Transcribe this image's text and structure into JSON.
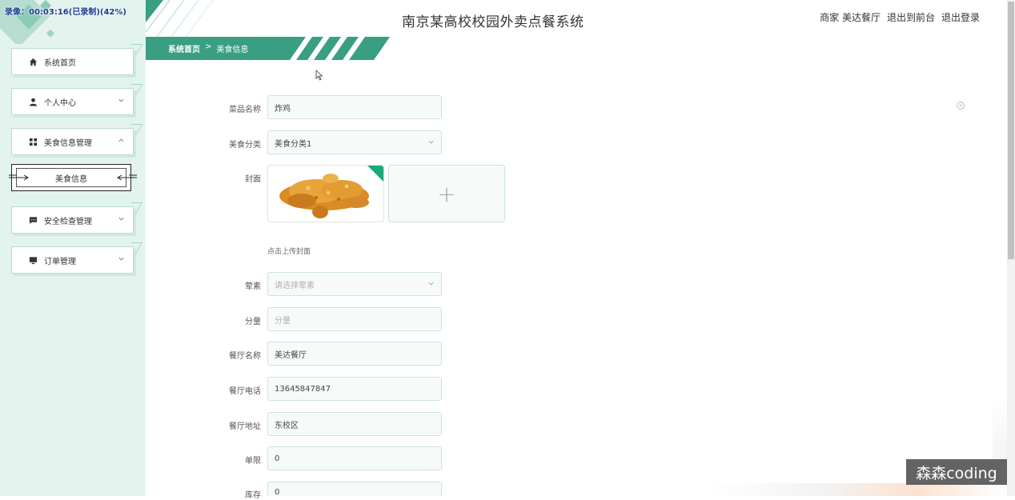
{
  "recording_badge": "录像：00:03:16(已录制)(42%)",
  "header": {
    "title": "南京某高校校园外卖点餐系统",
    "links": [
      "商家 美达餐厅",
      "退出到前台",
      "退出登录"
    ]
  },
  "breadcrumb": {
    "home": "系统首页",
    "separator": ">",
    "current": "美食信息"
  },
  "sidebar": {
    "items": [
      {
        "label": "系统首页",
        "icon": "home-icon"
      },
      {
        "label": "个人中心",
        "icon": "user-icon"
      },
      {
        "label": "美食信息管理",
        "icon": "grid-icon"
      },
      {
        "label": "安全检查管理",
        "icon": "chat-icon"
      },
      {
        "label": "订单管理",
        "icon": "monitor-icon"
      }
    ],
    "sub_item": "美食信息"
  },
  "form": {
    "dish_name": {
      "label": "菜品名称",
      "value": "炸鸡"
    },
    "category": {
      "label": "美食分类",
      "value": "美食分类1"
    },
    "cover": {
      "label": "封面",
      "hint": "点击上传封面",
      "add": "+"
    },
    "meat_veg": {
      "label": "荤素",
      "placeholder": "请选择荤素"
    },
    "portion": {
      "label": "分量",
      "placeholder": "分量"
    },
    "restaurant_name": {
      "label": "餐厅名称",
      "value": "美达餐厅"
    },
    "restaurant_phone": {
      "label": "餐厅电话",
      "value": "13645847847"
    },
    "restaurant_address": {
      "label": "餐厅地址",
      "value": "东校区"
    },
    "limit": {
      "label": "单限",
      "value": "0"
    },
    "stock": {
      "label": "库存",
      "value": "0"
    }
  },
  "watermark": "森森coding",
  "colors": {
    "accent": "#3a9e82",
    "sidebar_bg": "#e3f3ee",
    "field_border": "#cfe3dc"
  }
}
